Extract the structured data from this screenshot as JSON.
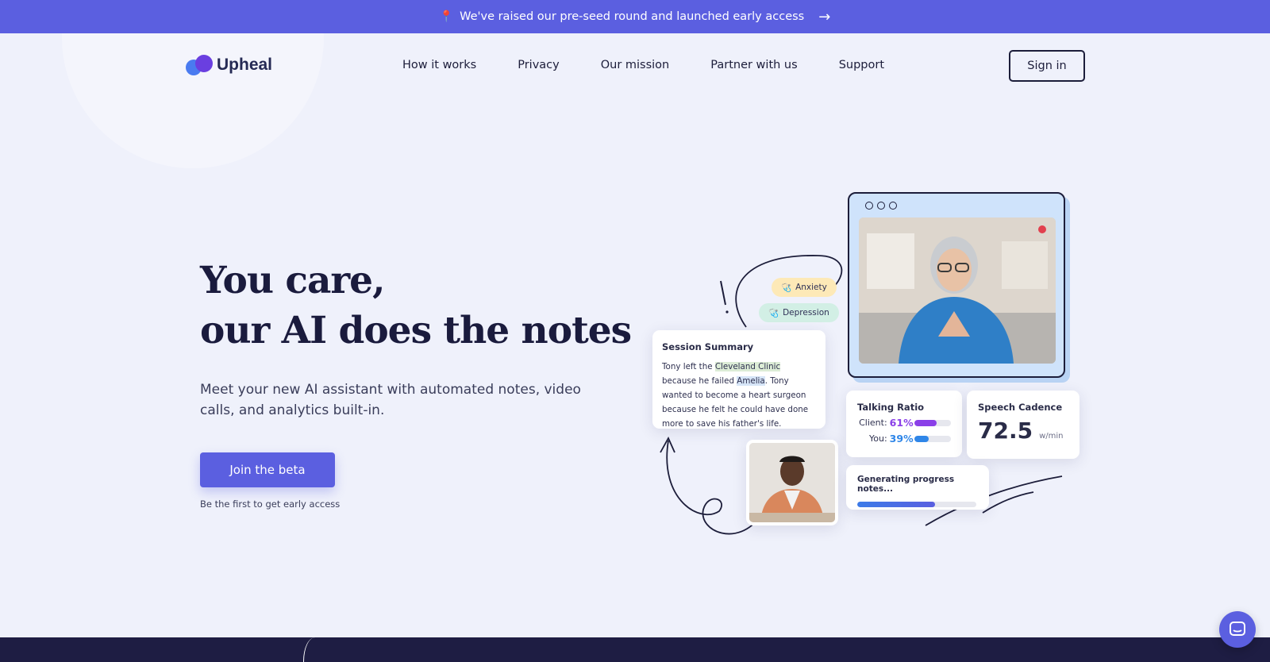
{
  "banner": {
    "icon": "pin-icon",
    "text": "We've raised our pre-seed round and launched early access",
    "arrow_icon": "arrow-right-icon"
  },
  "brand": {
    "name": "Upheal"
  },
  "nav": {
    "links": [
      "How it works",
      "Privacy",
      "Our mission",
      "Partner with us",
      "Support"
    ],
    "signin_label": "Sign in"
  },
  "hero": {
    "title_line1": "You care,",
    "title_line2": "our AI does the notes",
    "subtitle": "Meet your new AI assistant with automated notes, video calls, and analytics built-in.",
    "cta_label": "Join the beta",
    "note": "Be the first to get early access"
  },
  "illustration": {
    "tags": [
      "Anxiety",
      "Depression"
    ],
    "summary": {
      "title": "Session Summary",
      "segments": [
        {
          "text": "Tony left the ",
          "hl": ""
        },
        {
          "text": "Cleveland Clinic",
          "hl": "green"
        },
        {
          "text": " because he failed ",
          "hl": ""
        },
        {
          "text": "Amelia",
          "hl": "blue"
        },
        {
          "text": ". Tony wanted to become a heart surgeon because he felt he could have done more to save his father's life.",
          "hl": ""
        }
      ]
    },
    "talking_ratio": {
      "title": "Talking Ratio",
      "rows": [
        {
          "label": "Client:",
          "pct": "61%",
          "value": 0.61,
          "color": "#8a3fe8"
        },
        {
          "label": "You:",
          "pct": "39%",
          "value": 0.39,
          "color": "#2f86e8"
        }
      ]
    },
    "speech_cadence": {
      "title": "Speech Cadence",
      "value": "72.5",
      "unit": "w/min"
    },
    "progress_notes": {
      "title": "Generating progress notes...",
      "value": 0.65
    }
  },
  "colors": {
    "accent": "#5b5fe0",
    "dark": "#1e1d43",
    "background": "#eff1fb"
  },
  "chat_widget": {
    "icon": "chat-icon"
  }
}
